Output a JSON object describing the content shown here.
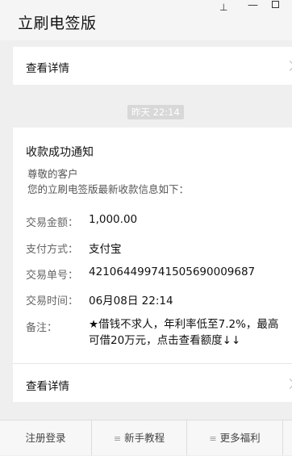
{
  "window": {
    "app_title": "立刷电签版",
    "pin_glyph": "⊥",
    "minimize_glyph": "—"
  },
  "top_card": {
    "view_details": "查看详情"
  },
  "message": {
    "time": "昨天 22:14",
    "title": "收款成功通知",
    "greeting": "尊敬的客户",
    "intro": "您的立刷电签版最新收款信息如下：",
    "fields": [
      {
        "label": "交易金额：",
        "value": "1,000.00"
      },
      {
        "label": "支付方式：",
        "value": "支付宝"
      },
      {
        "label": "交易单号：",
        "value": "421064499741505690009687"
      },
      {
        "label": "交易时间：",
        "value": "06月08日 22:14"
      },
      {
        "label": "备注：",
        "value": "★借钱不求人，年利率低至7.2%，最高可借20万元，点击查看额度↓↓"
      }
    ],
    "view_details": "查看详情"
  },
  "bottom_tabs": [
    {
      "label": "注册登录",
      "icon": ""
    },
    {
      "label": "新手教程",
      "icon": "≡"
    },
    {
      "label": "更多福利",
      "icon": "≡"
    }
  ],
  "icons": {
    "menu_icon_name": "menu-lines-icon",
    "chevron_icon_name": "chevron-right-icon"
  }
}
